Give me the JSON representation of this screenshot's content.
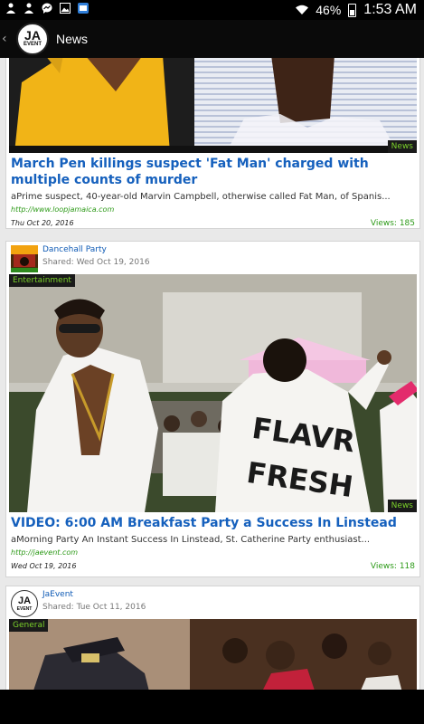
{
  "status_bar": {
    "battery": "46%",
    "time": "1:53 AM"
  },
  "app_bar": {
    "back_glyph": "‹",
    "logo_top": "JA",
    "logo_bottom": "EVENT",
    "title": "News"
  },
  "cards": [
    {
      "tag_bottom": "News",
      "title": "March Pen killings suspect 'Fat Man' charged with multiple counts of murder",
      "summary": "aPrime suspect, 40-year-old Marvin Campbell, otherwise called Fat Man, of Spanis...",
      "link": "http://www.loopjamaica.com",
      "date": "Thu Oct 20, 2016",
      "views": "Views: 185"
    },
    {
      "source": "Dancehall Party",
      "shared": "Shared: Wed Oct 19, 2016",
      "tag_top": "Entertainment",
      "tag_bottom": "News",
      "title": "VIDEO: 6:00 AM Breakfast Party a Success In Linstead",
      "summary": "aMorning Party An Instant Success In Linstead, St. Catherine    Party enthusiast...",
      "link": "http://jaevent.com",
      "date": "Wed Oct 19, 2016",
      "views": "Views: 118",
      "jacket_text_1": "FLAVR",
      "jacket_text_2": "FRESH"
    },
    {
      "source": "JaEvent",
      "shared": "Shared: Tue Oct 11, 2016",
      "tag_top": "General",
      "avatar_top": "JA",
      "avatar_bottom": "EVENT"
    }
  ]
}
